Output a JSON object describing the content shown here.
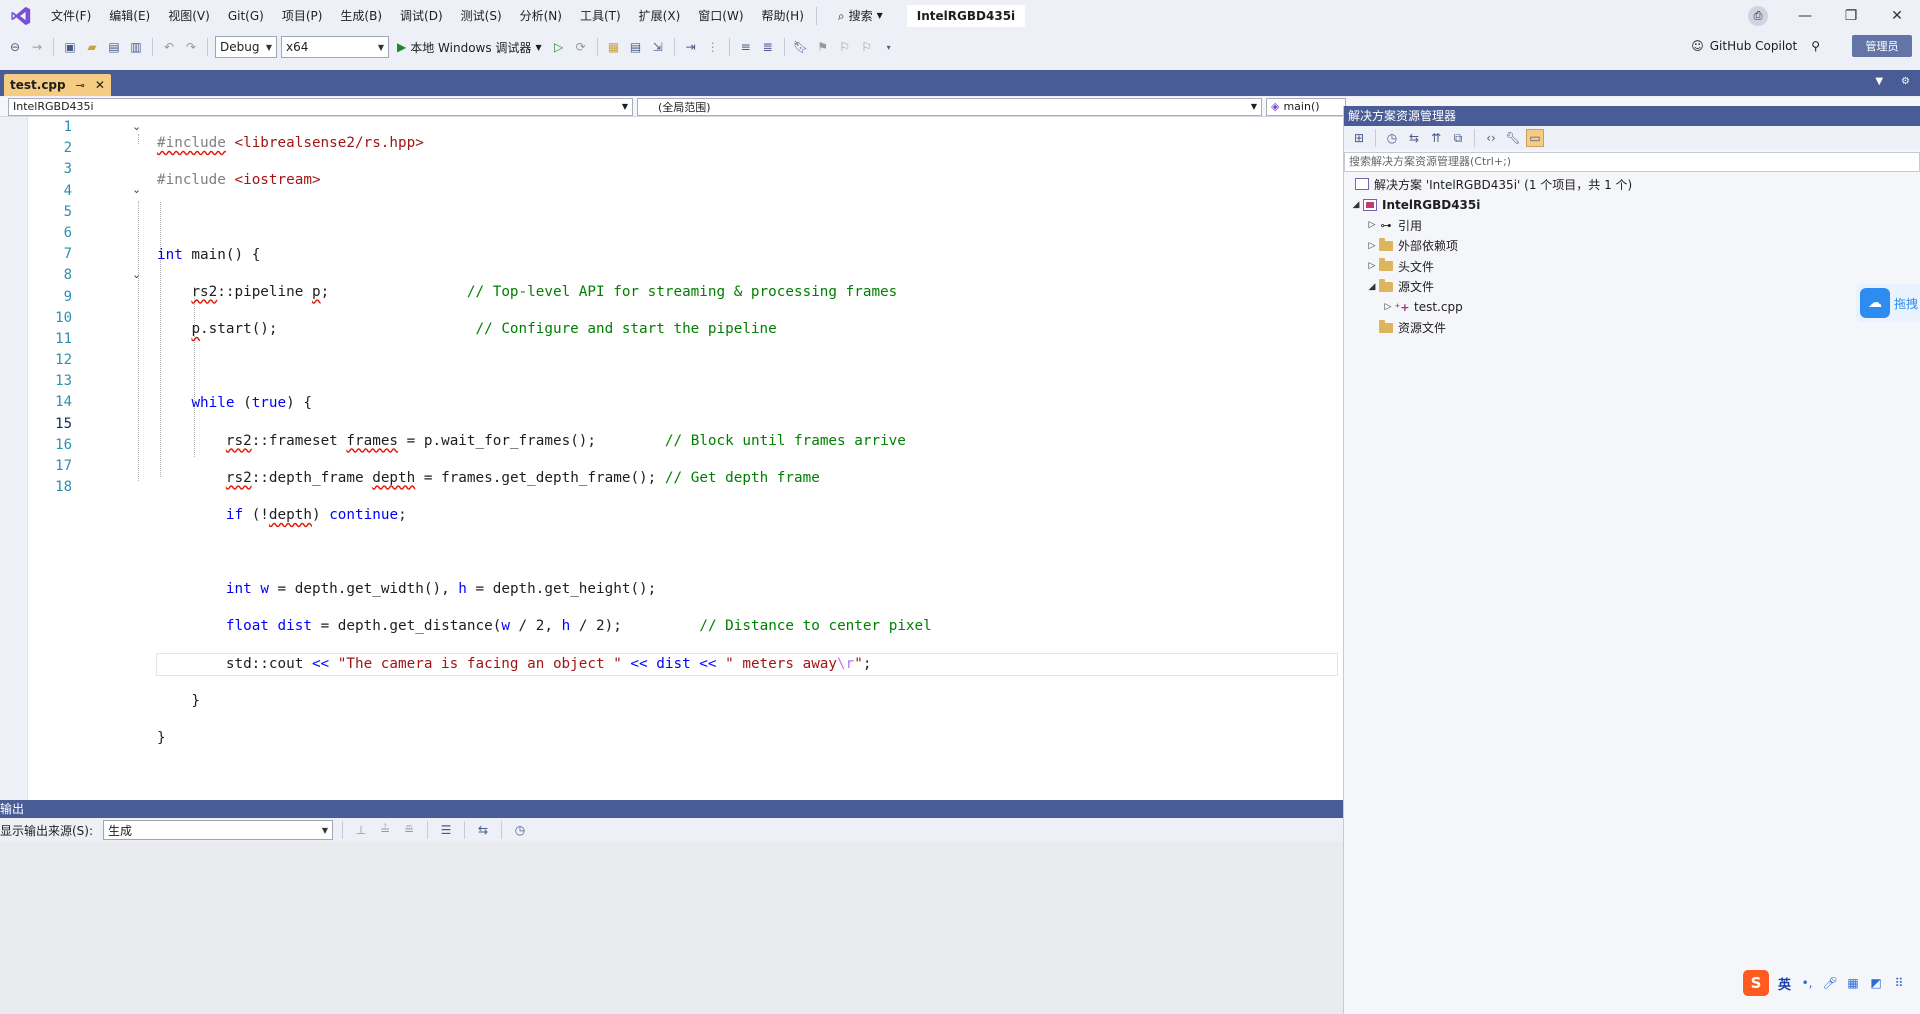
{
  "titlebar": {
    "menu": [
      "文件(F)",
      "编辑(E)",
      "视图(V)",
      "Git(G)",
      "项目(P)",
      "生成(B)",
      "调试(D)",
      "测试(S)",
      "分析(N)",
      "工具(T)",
      "扩展(X)",
      "窗口(W)",
      "帮助(H)"
    ],
    "search_label": "搜索",
    "project_title": "IntelRGBD435i"
  },
  "toolbar": {
    "config": "Debug",
    "platform": "x64",
    "run_label": "本地 Windows 调试器",
    "copilot": "GitHub Copilot",
    "admin": "管理员"
  },
  "tab": {
    "filename": "test.cpp"
  },
  "navbar": {
    "project": "IntelRGBD435i",
    "scope": "(全局范围)",
    "member": "main()"
  },
  "editor": {
    "current_line": 15,
    "line_numbers": [
      "1",
      "2",
      "3",
      "4",
      "5",
      "6",
      "7",
      "8",
      "9",
      "10",
      "11",
      "12",
      "13",
      "14",
      "15",
      "16",
      "17",
      "18"
    ]
  },
  "output": {
    "title": "输出",
    "source_label": "显示输出来源(S):",
    "source_value": "生成"
  },
  "solution_explorer": {
    "title": "解决方案资源管理器",
    "search_placeholder": "搜索解决方案资源管理器(Ctrl+;)",
    "solution_label": "解决方案 'IntelRGBD435i' (1 个项目，共 1 个)",
    "project": "IntelRGBD435i",
    "items": [
      {
        "label": "引用",
        "icon": "reference-icon"
      },
      {
        "label": "外部依赖项",
        "icon": "folder-icon"
      },
      {
        "label": "头文件",
        "icon": "folder-icon"
      },
      {
        "label": "源文件",
        "icon": "folder-icon"
      },
      {
        "label": "test.cpp",
        "icon": "cpp-file-icon"
      },
      {
        "label": "资源文件",
        "icon": "folder-icon"
      }
    ]
  },
  "side_widget": {
    "label": "拖拽"
  },
  "ime": {
    "lang": "英"
  }
}
